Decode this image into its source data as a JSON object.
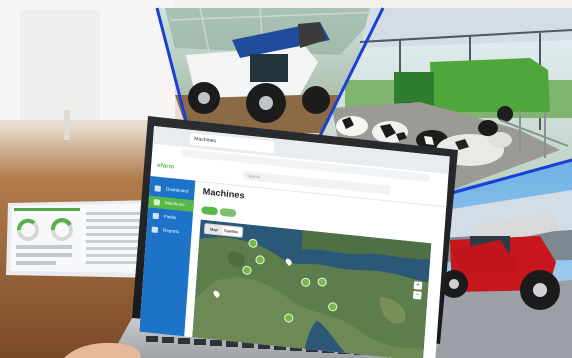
{
  "scene": {
    "description_free": true
  },
  "app": {
    "browser_tab": "Machines",
    "address": "",
    "logo": "efarm",
    "search_placeholder": "Search",
    "page_title": "Machines",
    "page_subtitle": "",
    "user_label": "",
    "sidebar": [
      {
        "label": "Dashboard",
        "active": false
      },
      {
        "label": "Machines",
        "active": true
      },
      {
        "label": "Fields",
        "active": false
      },
      {
        "label": "Reports",
        "active": false
      }
    ],
    "map_toggle": [
      "Map",
      "Satellite"
    ],
    "zoom_in": "+",
    "zoom_out": "−"
  },
  "tablet": {
    "gauge_left": "",
    "gauge_right": ""
  },
  "colors": {
    "sidebar_blue": "#1c73c8",
    "accent_green": "#55b848",
    "divider_blue": "#1a3fd6",
    "tractor_red": "#c8161d",
    "machine_white": "#f2f4f6",
    "feeder_green": "#4fa63a"
  },
  "icons": [
    "dashboard-icon",
    "tractor-icon",
    "field-icon",
    "report-icon",
    "search-icon",
    "map-marker-icon"
  ]
}
